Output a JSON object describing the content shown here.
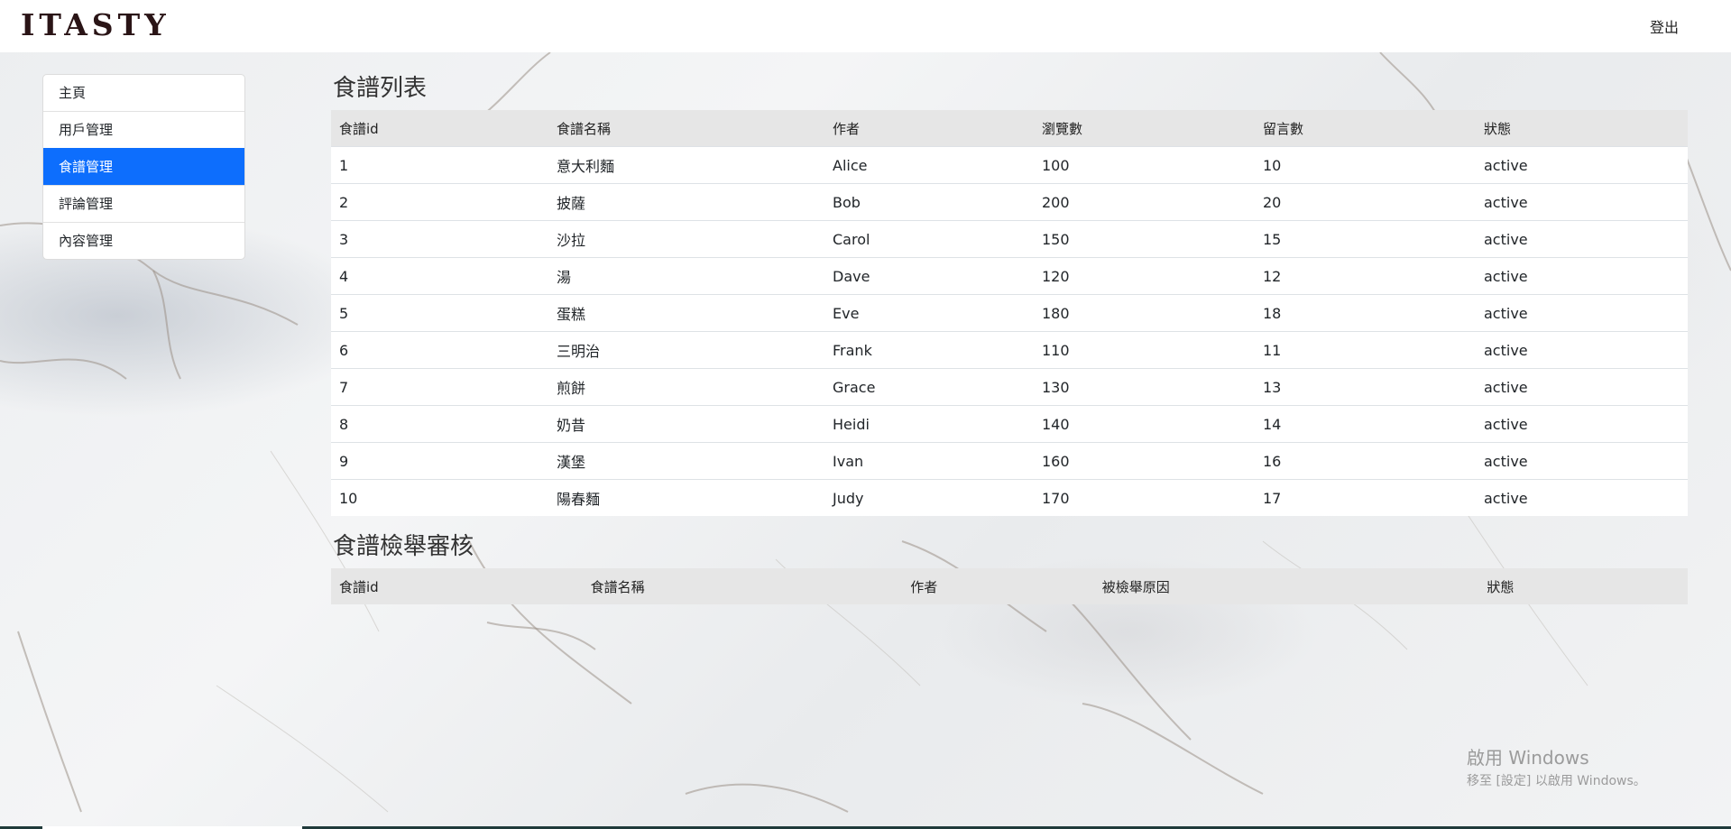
{
  "header": {
    "logo": "ITASTY",
    "logout_label": "登出"
  },
  "sidebar": {
    "items": [
      {
        "label": "主頁"
      },
      {
        "label": "用戶管理"
      },
      {
        "label": "食譜管理",
        "active": true
      },
      {
        "label": "評論管理"
      },
      {
        "label": "內容管理"
      }
    ]
  },
  "recipes": {
    "title": "食譜列表",
    "columns": [
      "食譜id",
      "食譜名稱",
      "作者",
      "瀏覽數",
      "留言數",
      "狀態"
    ],
    "rows": [
      [
        "1",
        "意大利麵",
        "Alice",
        "100",
        "10",
        "active"
      ],
      [
        "2",
        "披薩",
        "Bob",
        "200",
        "20",
        "active"
      ],
      [
        "3",
        "沙拉",
        "Carol",
        "150",
        "15",
        "active"
      ],
      [
        "4",
        "湯",
        "Dave",
        "120",
        "12",
        "active"
      ],
      [
        "5",
        "蛋糕",
        "Eve",
        "180",
        "18",
        "active"
      ],
      [
        "6",
        "三明治",
        "Frank",
        "110",
        "11",
        "active"
      ],
      [
        "7",
        "煎餅",
        "Grace",
        "130",
        "13",
        "active"
      ],
      [
        "8",
        "奶昔",
        "Heidi",
        "140",
        "14",
        "active"
      ],
      [
        "9",
        "漢堡",
        "Ivan",
        "160",
        "16",
        "active"
      ],
      [
        "10",
        "陽春麵",
        "Judy",
        "170",
        "17",
        "active"
      ]
    ]
  },
  "reports": {
    "title": "食譜檢舉審核",
    "columns": [
      "食譜id",
      "食譜名稱",
      "作者",
      "被檢舉原因",
      "狀態"
    ],
    "rows": []
  },
  "watermark": {
    "line1": "啟用 Windows",
    "line2": "移至 [設定] 以啟用 Windows。"
  },
  "colors": {
    "accent": "#0d6efd",
    "header_row": "#e6e6e6",
    "logo": "#2a1416"
  }
}
